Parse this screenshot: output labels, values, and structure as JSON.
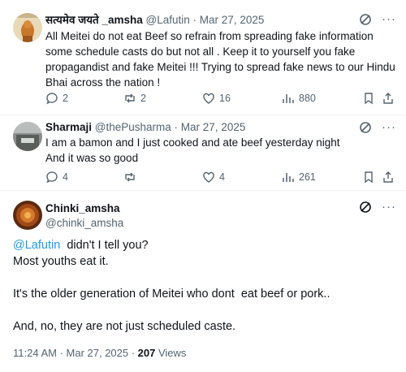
{
  "replies": [
    {
      "name": "सत्यमेव जयते _amsha",
      "handle": "@Lafutin",
      "date": "Mar 27, 2025",
      "text": "All Meitei do not eat Beef so refrain from spreading fake information some schedule casts do but not all . Keep it to yourself you fake propagandist and fake Meitei !!! Trying to spread fake news to our Hindu Bhai across the nation !",
      "replies": "2",
      "reposts": "2",
      "likes": "16",
      "views": "880"
    },
    {
      "name": "Sharmaji",
      "handle": "@thePusharma",
      "date": "Mar 27, 2025",
      "text_line1": "I am a bamon and I just cooked and ate beef yesterday night",
      "text_line2": "And it was so good",
      "replies": "4",
      "reposts": "",
      "likes": "4",
      "views": "261"
    }
  ],
  "main_post": {
    "name": "Chinki_amsha",
    "handle": "@chinki_amsha",
    "mention": "@Lafutin",
    "line1_rest": "  didn't I tell you?",
    "line2": "Most youths eat it.",
    "line3": "It's the older generation of Meitei who dont  eat beef or pork..",
    "line4": "And, no, they are not just scheduled caste.",
    "time": "11:24 AM · Mar 27, 2025 · ",
    "views_count": "207",
    "views_label": " Views"
  },
  "separator": " · ",
  "colors": {
    "accent": "#1d9bf0",
    "secondary_text": "#536471",
    "primary_text": "#0f1419",
    "divider": "#eff3f4"
  },
  "icons": [
    "reply-icon",
    "repost-icon",
    "like-icon",
    "views-icon",
    "bookmark-icon",
    "share-icon",
    "grok-icon",
    "more-icon"
  ]
}
